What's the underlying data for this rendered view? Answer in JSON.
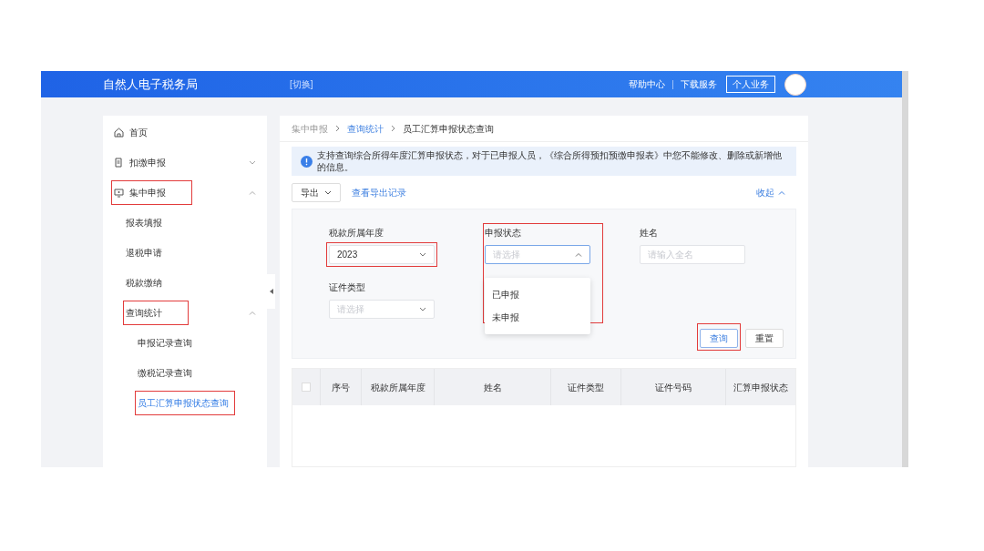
{
  "header": {
    "title": "自然人电子税务局",
    "switch_label": "[切换]",
    "links": [
      "帮助中心",
      "下载服务"
    ],
    "user_button": "个人业务"
  },
  "sidebar": {
    "items": [
      {
        "label": "首页",
        "selected": false,
        "highlighted": false
      },
      {
        "label": "扣缴申报",
        "selected": false,
        "highlighted": false,
        "expanded": false
      },
      {
        "label": "集中申报",
        "selected": false,
        "highlighted": true,
        "expanded": true,
        "children": [
          {
            "label": "报表填报",
            "selected": false,
            "highlighted": false
          },
          {
            "label": "退税申请",
            "selected": false,
            "highlighted": false
          },
          {
            "label": "税款缴纳",
            "selected": false,
            "highlighted": false
          },
          {
            "label": "查询统计",
            "selected": false,
            "highlighted": true,
            "expanded": true,
            "children": [
              {
                "label": "申报记录查询",
                "selected": false,
                "highlighted": false
              },
              {
                "label": "缴税记录查询",
                "selected": false,
                "highlighted": false
              },
              {
                "label": "员工汇算申报状态查询",
                "selected": true,
                "highlighted": true
              }
            ]
          }
        ]
      }
    ]
  },
  "breadcrumb": [
    {
      "label": "集中申报",
      "link": false
    },
    {
      "label": "查询统计",
      "link": true
    },
    {
      "label": "员工汇算申报状态查询",
      "link": false
    }
  ],
  "notice": "支持查询综合所得年度汇算申报状态，对于已申报人员，《综合所得预扣预缴申报表》中您不能修改、删除或新增他的信息。",
  "toolbar": {
    "export_button": "导出",
    "export_records_link": "查看导出记录",
    "collapse_link": "收起"
  },
  "filters": [
    {
      "kind": "select",
      "label": "税款所属年度",
      "value": "2023",
      "highlighted": true,
      "open": false
    },
    {
      "kind": "select",
      "label": "申报状态",
      "placeholder": "请选择",
      "highlighted": true,
      "open": true,
      "options": [
        "已申报",
        "未申报"
      ]
    },
    {
      "kind": "input",
      "label": "姓名",
      "placeholder": "请输入全名",
      "highlighted": false
    },
    {
      "kind": "select",
      "label": "证件类型",
      "placeholder": "请选择",
      "highlighted": false,
      "open": false
    }
  ],
  "actions": [
    {
      "label": "查询",
      "primary": true,
      "highlighted": true
    },
    {
      "label": "重置",
      "primary": false,
      "highlighted": false
    }
  ],
  "table": {
    "select_all_checked": false,
    "columns": [
      "序号",
      "税款所属年度",
      "姓名",
      "证件类型",
      "证件号码",
      "汇算申报状态"
    ]
  }
}
